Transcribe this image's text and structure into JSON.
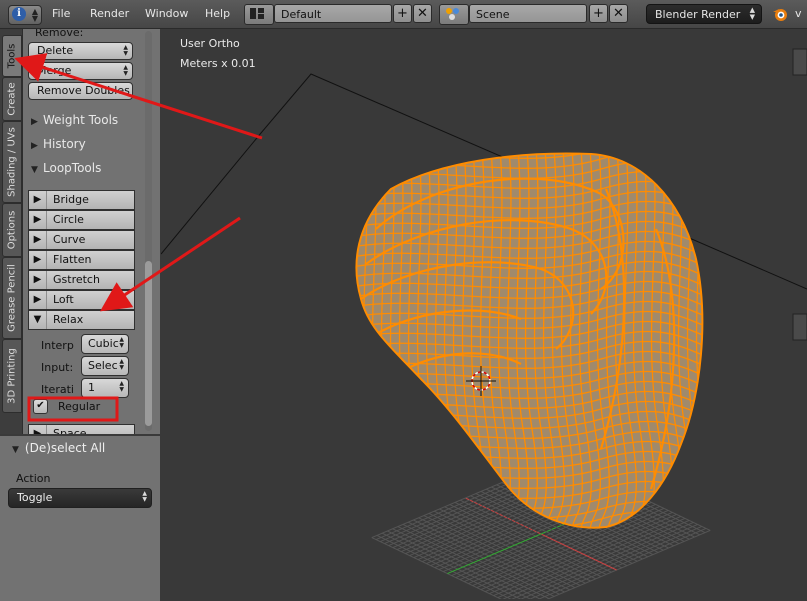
{
  "header": {
    "menus": [
      "File",
      "Render",
      "Window",
      "Help"
    ],
    "layout_value": "Default",
    "scene_value": "Scene",
    "render_engine": "Blender Render",
    "trailing_text": "v"
  },
  "tabs": [
    "Tools",
    "Create",
    "Shading / UVs",
    "Options",
    "Grease Pencil",
    "3D Printing"
  ],
  "toolshelf": {
    "remove_label": "Remove:",
    "remove_buttons": [
      "Delete",
      "Merge",
      "Remove Doubles"
    ],
    "panels": [
      "Weight Tools",
      "History",
      "LoopTools"
    ],
    "looptools": [
      "Bridge",
      "Circle",
      "Curve",
      "Flatten",
      "Gstretch",
      "Loft",
      "Relax"
    ],
    "relax": {
      "interp_label": "Interp",
      "interp_value": "Cubic",
      "input_label": "Input:",
      "input_value": "Selec",
      "iter_label": "Iterati",
      "iter_value": "1",
      "regular_label": "Regular"
    },
    "next_item": "Space"
  },
  "operator": {
    "title": "(De)select All",
    "action_label": "Action",
    "action_value": "Toggle"
  },
  "viewport": {
    "view_name": "User Ortho",
    "units": "Meters x 0.01"
  },
  "colors": {
    "mesh": "#ff8c00",
    "annotation": "#e01818",
    "header_bg": "#4e4e4e",
    "panel_bg": "#727272",
    "viewport_bg": "#393939"
  }
}
